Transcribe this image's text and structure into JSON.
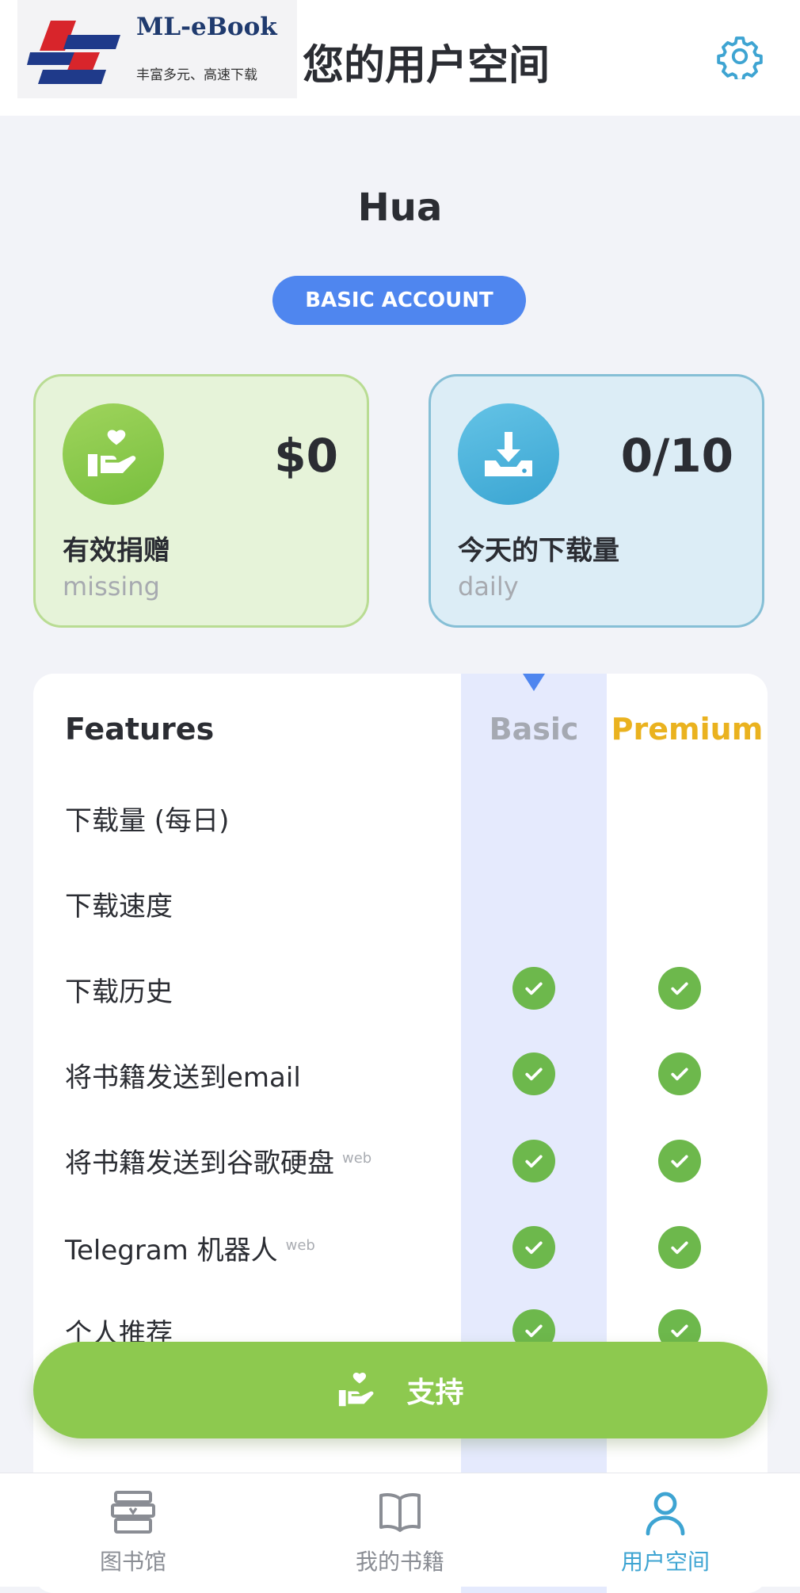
{
  "header": {
    "logo_name": "ML-eBook",
    "logo_tagline": "丰富多元、高速下载",
    "title": "您的用户空间",
    "settings_icon": "gear-icon"
  },
  "profile": {
    "username": "Hua",
    "account_badge": "BASIC ACCOUNT"
  },
  "stats": {
    "donation": {
      "value": "$0",
      "label": "有效捐赠",
      "sub": "missing",
      "icon": "donate-hand-heart-icon"
    },
    "downloads": {
      "value": "0/10",
      "label": "今天的下载量",
      "sub": "daily",
      "icon": "download-tray-icon"
    }
  },
  "features": {
    "heading": "Features",
    "columns": [
      "Basic",
      "Premium"
    ],
    "rows": [
      {
        "label": "下载量 (每日)",
        "tag": "",
        "basic": false,
        "premium": false
      },
      {
        "label": "下载速度",
        "tag": "",
        "basic": false,
        "premium": false
      },
      {
        "label": "下载历史",
        "tag": "",
        "basic": true,
        "premium": true
      },
      {
        "label": "将书籍发送到email",
        "tag": "",
        "basic": true,
        "premium": true
      },
      {
        "label": "将书籍发送到谷歌硬盘",
        "tag": "web",
        "basic": true,
        "premium": true
      },
      {
        "label": "Telegram 机器人",
        "tag": "web",
        "basic": true,
        "premium": true
      },
      {
        "label": "个人推荐",
        "tag": "",
        "basic": true,
        "premium": true
      }
    ]
  },
  "support_button": {
    "label": "支持",
    "icon": "donate-hand-heart-icon"
  },
  "bottom_nav": [
    {
      "label": "图书馆",
      "icon": "library-books-icon",
      "active": false
    },
    {
      "label": "我的书籍",
      "icon": "open-book-icon",
      "active": false
    },
    {
      "label": "用户空间",
      "icon": "user-icon",
      "active": true
    }
  ],
  "colors": {
    "accent_blue": "#4f86ef",
    "donate_green": "#8dc94f",
    "download_blue": "#3ea4d2",
    "premium_gold": "#eab21f",
    "check_green": "#6db84c"
  }
}
